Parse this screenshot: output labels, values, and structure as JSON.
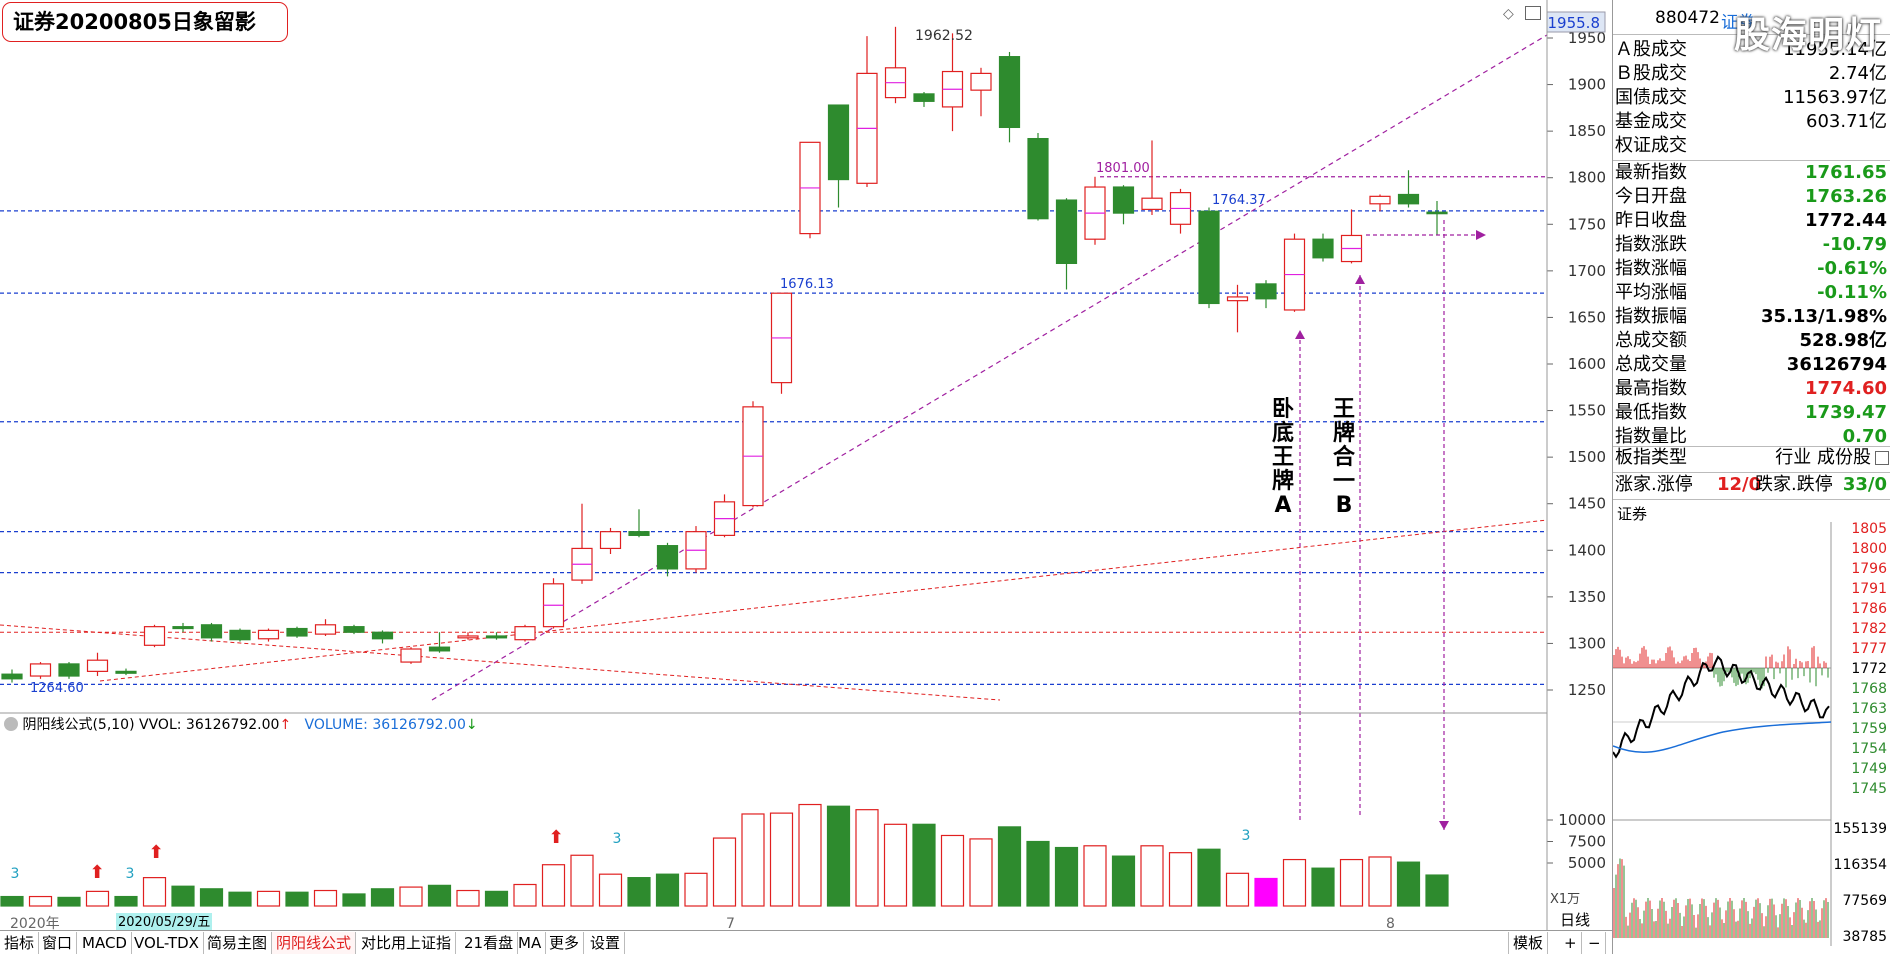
{
  "title": "证券20200805日象留影",
  "chart_data": {
    "type": "candlestick",
    "price_axis": {
      "ticks": [
        1950,
        1900,
        1850,
        1800,
        1750,
        1700,
        1650,
        1600,
        1550,
        1500,
        1450,
        1400,
        1350,
        1300,
        1250
      ],
      "current_label": "1955.8"
    },
    "volume_axis": {
      "ticks": [
        10000,
        7500,
        5000
      ],
      "unit": "X1万"
    },
    "candles": [
      {
        "o": 1267,
        "h": 1272,
        "l": 1258,
        "c": 1262
      },
      {
        "o": 1265,
        "h": 1280,
        "l": 1262,
        "c": 1278
      },
      {
        "o": 1278,
        "h": 1280,
        "l": 1262,
        "c": 1265
      },
      {
        "o": 1270,
        "h": 1290,
        "l": 1265,
        "c": 1282
      },
      {
        "o": 1270,
        "h": 1273,
        "l": 1266,
        "c": 1268
      },
      {
        "o": 1298,
        "h": 1320,
        "l": 1296,
        "c": 1318
      },
      {
        "o": 1318,
        "h": 1322,
        "l": 1312,
        "c": 1316
      },
      {
        "o": 1320,
        "h": 1322,
        "l": 1302,
        "c": 1306
      },
      {
        "o": 1314,
        "h": 1316,
        "l": 1302,
        "c": 1304
      },
      {
        "o": 1305,
        "h": 1316,
        "l": 1302,
        "c": 1314
      },
      {
        "o": 1316,
        "h": 1318,
        "l": 1306,
        "c": 1308
      },
      {
        "o": 1310,
        "h": 1326,
        "l": 1308,
        "c": 1320
      },
      {
        "o": 1318,
        "h": 1320,
        "l": 1310,
        "c": 1312
      },
      {
        "o": 1312,
        "h": 1314,
        "l": 1300,
        "c": 1305
      },
      {
        "o": 1280,
        "h": 1296,
        "l": 1278,
        "c": 1294
      },
      {
        "o": 1296,
        "h": 1312,
        "l": 1290,
        "c": 1292
      },
      {
        "o": 1306,
        "h": 1312,
        "l": 1304,
        "c": 1308
      },
      {
        "o": 1308,
        "h": 1312,
        "l": 1304,
        "c": 1306
      },
      {
        "o": 1304,
        "h": 1320,
        "l": 1302,
        "c": 1318
      },
      {
        "o": 1318,
        "h": 1370,
        "l": 1316,
        "c": 1364
      },
      {
        "o": 1368,
        "h": 1450,
        "l": 1364,
        "c": 1402
      },
      {
        "o": 1402,
        "h": 1424,
        "l": 1396,
        "c": 1420
      },
      {
        "o": 1420,
        "h": 1444,
        "l": 1414,
        "c": 1416
      },
      {
        "o": 1405,
        "h": 1408,
        "l": 1372,
        "c": 1380
      },
      {
        "o": 1380,
        "h": 1426,
        "l": 1376,
        "c": 1420
      },
      {
        "o": 1416,
        "h": 1460,
        "l": 1414,
        "c": 1452
      },
      {
        "o": 1448,
        "h": 1560,
        "l": 1446,
        "c": 1554
      },
      {
        "o": 1580,
        "h": 1676,
        "l": 1568,
        "c": 1676
      },
      {
        "o": 1740,
        "h": 1838,
        "l": 1735,
        "c": 1838
      },
      {
        "o": 1878,
        "h": 1878,
        "l": 1768,
        "c": 1798
      },
      {
        "o": 1794,
        "h": 1952,
        "l": 1790,
        "c": 1912
      },
      {
        "o": 1886,
        "h": 1962,
        "l": 1880,
        "c": 1918
      },
      {
        "o": 1890,
        "h": 1892,
        "l": 1876,
        "c": 1882
      },
      {
        "o": 1876,
        "h": 1955,
        "l": 1850,
        "c": 1914
      },
      {
        "o": 1894,
        "h": 1918,
        "l": 1866,
        "c": 1912
      },
      {
        "o": 1930,
        "h": 1935,
        "l": 1838,
        "c": 1854
      },
      {
        "o": 1842,
        "h": 1848,
        "l": 1754,
        "c": 1756
      },
      {
        "o": 1776,
        "h": 1778,
        "l": 1680,
        "c": 1708
      },
      {
        "o": 1734,
        "h": 1801,
        "l": 1728,
        "c": 1790
      },
      {
        "o": 1790,
        "h": 1792,
        "l": 1750,
        "c": 1762
      },
      {
        "o": 1766,
        "h": 1840,
        "l": 1760,
        "c": 1778
      },
      {
        "o": 1750,
        "h": 1788,
        "l": 1740,
        "c": 1784
      },
      {
        "o": 1764,
        "h": 1768,
        "l": 1660,
        "c": 1665
      },
      {
        "o": 1668,
        "h": 1685,
        "l": 1634,
        "c": 1672
      },
      {
        "o": 1686,
        "h": 1690,
        "l": 1660,
        "c": 1670
      },
      {
        "o": 1658,
        "h": 1740,
        "l": 1656,
        "c": 1734
      },
      {
        "o": 1734,
        "h": 1740,
        "l": 1710,
        "c": 1714
      },
      {
        "o": 1710,
        "h": 1766,
        "l": 1708,
        "c": 1738
      },
      {
        "o": 1772,
        "h": 1782,
        "l": 1764,
        "c": 1780
      },
      {
        "o": 1782,
        "h": 1808,
        "l": 1768,
        "c": 1772
      },
      {
        "o": 1763,
        "h": 1775,
        "l": 1739,
        "c": 1762
      }
    ],
    "volumes": [
      1100,
      1100,
      1000,
      1700,
      1100,
      3300,
      2300,
      2000,
      1600,
      1700,
      1600,
      1800,
      1400,
      2000,
      2200,
      2400,
      1800,
      1700,
      2500,
      4800,
      5900,
      3700,
      3300,
      3700,
      3800,
      7900,
      10700,
      10800,
      11800,
      11600,
      11200,
      9500,
      9500,
      8200,
      7800,
      9200,
      7500,
      6800,
      7000,
      5800,
      7000,
      6200,
      6600,
      3800,
      3200,
      5400,
      4400,
      5400,
      5700,
      5100,
      3600
    ],
    "annotations": {
      "high_label": "1962.52",
      "mid_high_label": "1801.00",
      "level_1676": "1676.13",
      "level_1764": "1764.37",
      "low_label": "1264.60",
      "text_a": "卧底王牌A",
      "text_b": "王牌合一B"
    },
    "indicator_header": {
      "name": "阴阳线公式(5,10)",
      "vvol": "VVOL: 36126792.00",
      "volume": "VOLUME: 36126792.00"
    },
    "x_labels": {
      "year": "2020年",
      "cursor_date": "2020/05/29/五",
      "m7": "7",
      "m8": "8"
    }
  },
  "quote_panel": {
    "code": "880472",
    "name": "证券",
    "watermark": "股海明灯",
    "rows_a": [
      {
        "label": "Ａ股成交",
        "value": "11955.14亿",
        "color": "#000"
      },
      {
        "label": "Ｂ股成交",
        "value": "2.74亿",
        "color": "#000"
      },
      {
        "label": "国债成交",
        "value": "11563.97亿",
        "color": "#000"
      },
      {
        "label": "基金成交",
        "value": "603.71亿",
        "color": "#000"
      },
      {
        "label": "权证成交",
        "value": "",
        "color": "#000"
      }
    ],
    "rows_b": [
      {
        "label": "最新指数",
        "value": "1761.65",
        "color": "#1a9a1a"
      },
      {
        "label": "今日开盘",
        "value": "1763.26",
        "color": "#1a9a1a"
      },
      {
        "label": "昨日收盘",
        "value": "1772.44",
        "color": "#000"
      },
      {
        "label": "指数涨跌",
        "value": "-10.79",
        "color": "#1a9a1a"
      },
      {
        "label": "指数涨幅",
        "value": "-0.61%",
        "color": "#1a9a1a"
      },
      {
        "label": "平均涨幅",
        "value": "-0.11%",
        "color": "#1a9a1a"
      },
      {
        "label": "指数振幅",
        "value": "35.13/1.98%",
        "color": "#000"
      },
      {
        "label": "总成交额",
        "value": "528.98亿",
        "color": "#000"
      },
      {
        "label": "总成交量",
        "value": "36126794",
        "color": "#000"
      },
      {
        "label": "最高指数",
        "value": "1774.60",
        "color": "#e02020"
      },
      {
        "label": "最低指数",
        "value": "1739.47",
        "color": "#1a9a1a"
      },
      {
        "label": "指数量比",
        "value": "0.70",
        "color": "#1a9a1a"
      }
    ],
    "board_type_label": "板指类型",
    "board_type_value": "行业 成份股",
    "up_label": "涨家.涨停",
    "up_value": "12/0",
    "down_label": "跌家.跌停",
    "down_value": "33/0",
    "mini_title": "证券",
    "mini_price_ticks": [
      "1805",
      "1800",
      "1796",
      "1791",
      "1786",
      "1782",
      "1777",
      "1772",
      "1768",
      "1763",
      "1759",
      "1754",
      "1749",
      "1745"
    ],
    "mini_vol_ticks": [
      "155139",
      "116354",
      "77569",
      "38785"
    ]
  },
  "toolbar": {
    "tabs": [
      "指标",
      "窗口",
      "MACD",
      "VOL-TDX",
      "简易主图",
      "阴阳线公式",
      "对比用上证指",
      "21看盘",
      "MA",
      "更多",
      "设置"
    ],
    "active_tab": "阴阳线公式",
    "right_items": [
      "模板",
      "+",
      "−"
    ],
    "daily_label": "日线"
  }
}
